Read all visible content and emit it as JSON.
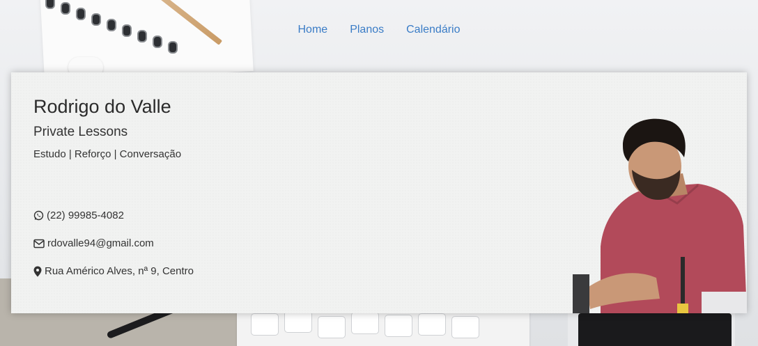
{
  "nav": {
    "items": [
      "Home",
      "Planos",
      "Calendário"
    ]
  },
  "profile": {
    "name": "Rodrigo do Valle",
    "subtitle": "Private Lessons",
    "tagline": "Estudo | Reforço | Conversação"
  },
  "contacts": {
    "phone": {
      "icon": "whatsapp-icon",
      "text": "(22) 99985-4082"
    },
    "email": {
      "icon": "envelope-icon",
      "text": "rdovalle94@gmail.com"
    },
    "address": {
      "icon": "map-marker-icon",
      "text": "Rua Américo Alves, nª 9, Centro"
    }
  },
  "colors": {
    "nav_link": "#3a7cc6",
    "card_bg": "#f1f2f1",
    "text": "#333333"
  }
}
